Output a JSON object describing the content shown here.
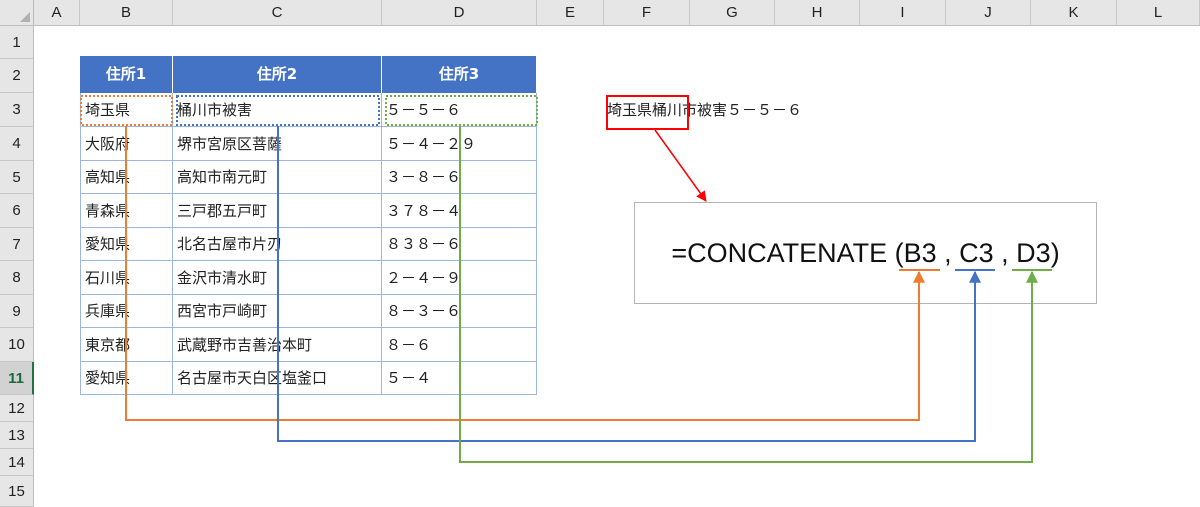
{
  "columns": [
    "A",
    "B",
    "C",
    "D",
    "E",
    "F",
    "G",
    "H",
    "I",
    "J",
    "K",
    "L"
  ],
  "rows": [
    "1",
    "2",
    "3",
    "4",
    "5",
    "6",
    "7",
    "8",
    "9",
    "10",
    "11",
    "12",
    "13",
    "14",
    "15"
  ],
  "active_row": "11",
  "table": {
    "headers": [
      "住所1",
      "住所2",
      "住所3"
    ],
    "rows": [
      [
        "埼玉県",
        "桶川市被害",
        "５－５－６"
      ],
      [
        "大阪府",
        "堺市宮原区菩薩",
        "５－４－２９"
      ],
      [
        "高知県",
        "高知市南元町",
        "３－８－６"
      ],
      [
        "青森県",
        "三戸郡五戸町",
        "３７８－４"
      ],
      [
        "愛知県",
        "北名古屋市片刃",
        "８３８－６"
      ],
      [
        "石川県",
        "金沢市清水町",
        "２－４－９"
      ],
      [
        "兵庫県",
        "西宮市戸崎町",
        "８－３－６"
      ],
      [
        "東京都",
        "武蔵野市吉善治本町",
        "８－６"
      ],
      [
        "愛知県",
        "名古屋市天白区塩釜口",
        "５－４"
      ]
    ]
  },
  "result_text": "埼玉県桶川市被害５－５－６",
  "formula": {
    "prefix": "=CONCATENATE (",
    "arg1": "B3",
    "sep1": " , ",
    "arg2": "C3",
    "sep2": " , ",
    "arg3": "D3",
    "suffix": ")"
  },
  "colors": {
    "header_fill": "#4472c4",
    "arrow_b": "#ed7d31",
    "arrow_c": "#4472c4",
    "arrow_d": "#70ad47",
    "highlight": "#ff0000",
    "active_row_accent": "#217346"
  }
}
